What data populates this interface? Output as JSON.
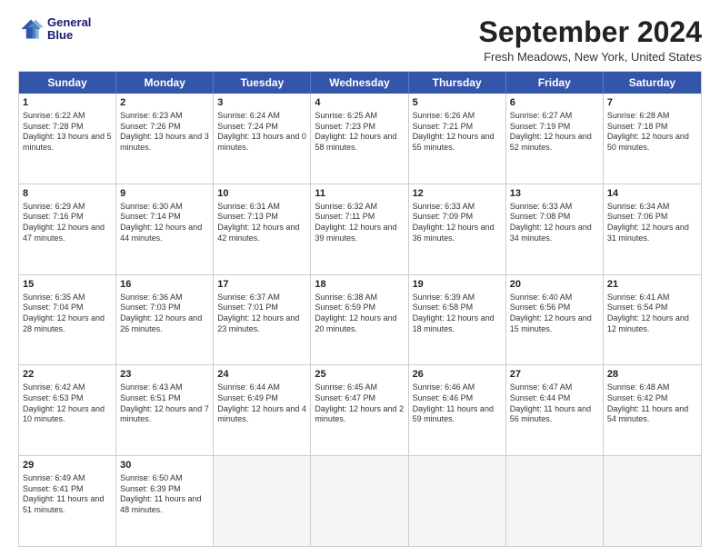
{
  "header": {
    "logo_line1": "General",
    "logo_line2": "Blue",
    "month_title": "September 2024",
    "location": "Fresh Meadows, New York, United States"
  },
  "weekdays": [
    "Sunday",
    "Monday",
    "Tuesday",
    "Wednesday",
    "Thursday",
    "Friday",
    "Saturday"
  ],
  "rows": [
    [
      {
        "day": "",
        "empty": true
      },
      {
        "day": "",
        "empty": true
      },
      {
        "day": "",
        "empty": true
      },
      {
        "day": "",
        "empty": true
      },
      {
        "day": "",
        "empty": true
      },
      {
        "day": "",
        "empty": true
      },
      {
        "day": "",
        "empty": true
      }
    ],
    [
      {
        "day": "1",
        "sunrise": "Sunrise: 6:22 AM",
        "sunset": "Sunset: 7:28 PM",
        "daylight": "Daylight: 13 hours and 5 minutes."
      },
      {
        "day": "2",
        "sunrise": "Sunrise: 6:23 AM",
        "sunset": "Sunset: 7:26 PM",
        "daylight": "Daylight: 13 hours and 3 minutes."
      },
      {
        "day": "3",
        "sunrise": "Sunrise: 6:24 AM",
        "sunset": "Sunset: 7:24 PM",
        "daylight": "Daylight: 13 hours and 0 minutes."
      },
      {
        "day": "4",
        "sunrise": "Sunrise: 6:25 AM",
        "sunset": "Sunset: 7:23 PM",
        "daylight": "Daylight: 12 hours and 58 minutes."
      },
      {
        "day": "5",
        "sunrise": "Sunrise: 6:26 AM",
        "sunset": "Sunset: 7:21 PM",
        "daylight": "Daylight: 12 hours and 55 minutes."
      },
      {
        "day": "6",
        "sunrise": "Sunrise: 6:27 AM",
        "sunset": "Sunset: 7:19 PM",
        "daylight": "Daylight: 12 hours and 52 minutes."
      },
      {
        "day": "7",
        "sunrise": "Sunrise: 6:28 AM",
        "sunset": "Sunset: 7:18 PM",
        "daylight": "Daylight: 12 hours and 50 minutes."
      }
    ],
    [
      {
        "day": "8",
        "sunrise": "Sunrise: 6:29 AM",
        "sunset": "Sunset: 7:16 PM",
        "daylight": "Daylight: 12 hours and 47 minutes."
      },
      {
        "day": "9",
        "sunrise": "Sunrise: 6:30 AM",
        "sunset": "Sunset: 7:14 PM",
        "daylight": "Daylight: 12 hours and 44 minutes."
      },
      {
        "day": "10",
        "sunrise": "Sunrise: 6:31 AM",
        "sunset": "Sunset: 7:13 PM",
        "daylight": "Daylight: 12 hours and 42 minutes."
      },
      {
        "day": "11",
        "sunrise": "Sunrise: 6:32 AM",
        "sunset": "Sunset: 7:11 PM",
        "daylight": "Daylight: 12 hours and 39 minutes."
      },
      {
        "day": "12",
        "sunrise": "Sunrise: 6:33 AM",
        "sunset": "Sunset: 7:09 PM",
        "daylight": "Daylight: 12 hours and 36 minutes."
      },
      {
        "day": "13",
        "sunrise": "Sunrise: 6:33 AM",
        "sunset": "Sunset: 7:08 PM",
        "daylight": "Daylight: 12 hours and 34 minutes."
      },
      {
        "day": "14",
        "sunrise": "Sunrise: 6:34 AM",
        "sunset": "Sunset: 7:06 PM",
        "daylight": "Daylight: 12 hours and 31 minutes."
      }
    ],
    [
      {
        "day": "15",
        "sunrise": "Sunrise: 6:35 AM",
        "sunset": "Sunset: 7:04 PM",
        "daylight": "Daylight: 12 hours and 28 minutes."
      },
      {
        "day": "16",
        "sunrise": "Sunrise: 6:36 AM",
        "sunset": "Sunset: 7:03 PM",
        "daylight": "Daylight: 12 hours and 26 minutes."
      },
      {
        "day": "17",
        "sunrise": "Sunrise: 6:37 AM",
        "sunset": "Sunset: 7:01 PM",
        "daylight": "Daylight: 12 hours and 23 minutes."
      },
      {
        "day": "18",
        "sunrise": "Sunrise: 6:38 AM",
        "sunset": "Sunset: 6:59 PM",
        "daylight": "Daylight: 12 hours and 20 minutes."
      },
      {
        "day": "19",
        "sunrise": "Sunrise: 6:39 AM",
        "sunset": "Sunset: 6:58 PM",
        "daylight": "Daylight: 12 hours and 18 minutes."
      },
      {
        "day": "20",
        "sunrise": "Sunrise: 6:40 AM",
        "sunset": "Sunset: 6:56 PM",
        "daylight": "Daylight: 12 hours and 15 minutes."
      },
      {
        "day": "21",
        "sunrise": "Sunrise: 6:41 AM",
        "sunset": "Sunset: 6:54 PM",
        "daylight": "Daylight: 12 hours and 12 minutes."
      }
    ],
    [
      {
        "day": "22",
        "sunrise": "Sunrise: 6:42 AM",
        "sunset": "Sunset: 6:53 PM",
        "daylight": "Daylight: 12 hours and 10 minutes."
      },
      {
        "day": "23",
        "sunrise": "Sunrise: 6:43 AM",
        "sunset": "Sunset: 6:51 PM",
        "daylight": "Daylight: 12 hours and 7 minutes."
      },
      {
        "day": "24",
        "sunrise": "Sunrise: 6:44 AM",
        "sunset": "Sunset: 6:49 PM",
        "daylight": "Daylight: 12 hours and 4 minutes."
      },
      {
        "day": "25",
        "sunrise": "Sunrise: 6:45 AM",
        "sunset": "Sunset: 6:47 PM",
        "daylight": "Daylight: 12 hours and 2 minutes."
      },
      {
        "day": "26",
        "sunrise": "Sunrise: 6:46 AM",
        "sunset": "Sunset: 6:46 PM",
        "daylight": "Daylight: 11 hours and 59 minutes."
      },
      {
        "day": "27",
        "sunrise": "Sunrise: 6:47 AM",
        "sunset": "Sunset: 6:44 PM",
        "daylight": "Daylight: 11 hours and 56 minutes."
      },
      {
        "day": "28",
        "sunrise": "Sunrise: 6:48 AM",
        "sunset": "Sunset: 6:42 PM",
        "daylight": "Daylight: 11 hours and 54 minutes."
      }
    ],
    [
      {
        "day": "29",
        "sunrise": "Sunrise: 6:49 AM",
        "sunset": "Sunset: 6:41 PM",
        "daylight": "Daylight: 11 hours and 51 minutes."
      },
      {
        "day": "30",
        "sunrise": "Sunrise: 6:50 AM",
        "sunset": "Sunset: 6:39 PM",
        "daylight": "Daylight: 11 hours and 48 minutes."
      },
      {
        "day": "",
        "empty": true
      },
      {
        "day": "",
        "empty": true
      },
      {
        "day": "",
        "empty": true
      },
      {
        "day": "",
        "empty": true
      },
      {
        "day": "",
        "empty": true
      }
    ]
  ]
}
